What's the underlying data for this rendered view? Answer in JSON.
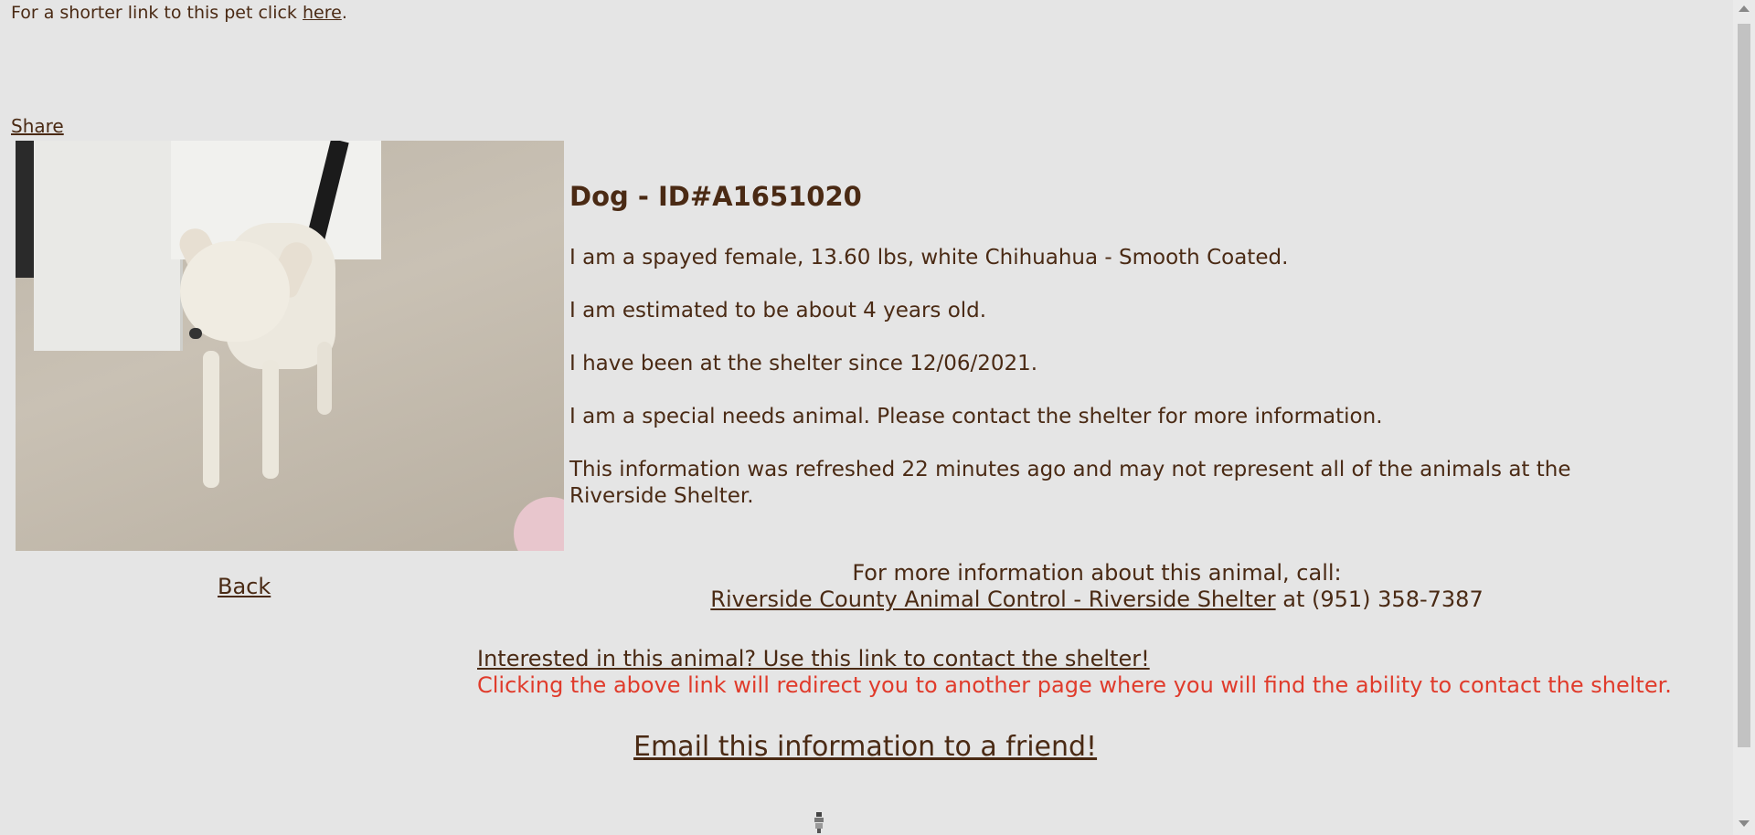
{
  "top": {
    "prefix": "For a shorter link to this pet click ",
    "link": "here",
    "suffix": "."
  },
  "share_label": "Share",
  "pet": {
    "title": "Dog - ID#A1651020",
    "description": "I am a spayed female, 13.60 lbs, white Chihuahua - Smooth Coated.",
    "age": "I am estimated to be about 4 years old.",
    "since": "I have been at the shelter since 12/06/2021.",
    "special_needs": "I am a special needs animal. Please contact the shelter for more information.",
    "refresh_note": "This information was refreshed 22 minutes ago and may not represent all of the animals at the Riverside Shelter."
  },
  "back_label": "Back",
  "contact": {
    "intro": "For more information about this animal, call:",
    "shelter_link": "Riverside County Animal Control - Riverside Shelter",
    "phone_text": " at (951) 358-7387"
  },
  "interested_link": "Interested in this animal? Use this link to contact the shelter!",
  "redirect_note": "Clicking the above link will redirect you to another page where you will find the ability to contact the shelter.",
  "email_link": "Email this information to a friend!",
  "colors": {
    "background": "#e5e5e5",
    "text": "#4a2a14",
    "warning": "#e03b2b"
  },
  "icons": {
    "loading": "spinner-icon",
    "scroll_up": "chevron-up-icon",
    "scroll_down": "chevron-down-icon"
  }
}
